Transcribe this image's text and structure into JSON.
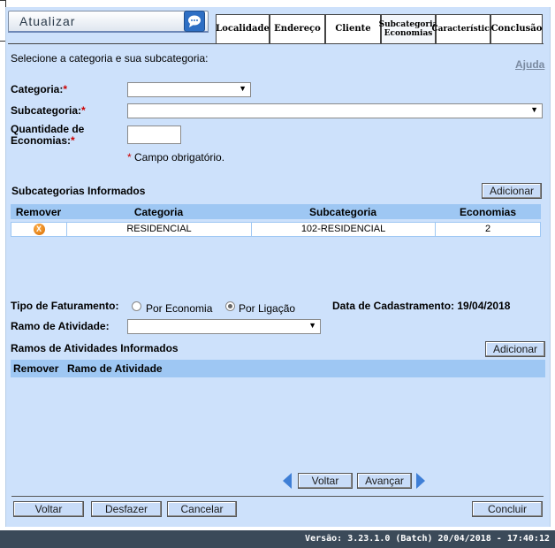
{
  "window": {
    "title": "Atualizar"
  },
  "tabs": [
    {
      "label": "Localidade"
    },
    {
      "label": "Endereço"
    },
    {
      "label": "Cliente"
    },
    {
      "label": "Subcategoria Economias"
    },
    {
      "label": "Característica"
    },
    {
      "label": "Conclusão"
    }
  ],
  "form": {
    "instruction": "Selecione a categoria e sua subcategoria:",
    "help_link": "Ajuda",
    "categoria_label": "Categoria:",
    "subcategoria_label": "Subcategoria:",
    "quantidade_label_line1": "Quantidade de",
    "quantidade_label_line2": "Economias:",
    "required_mark": "*",
    "required_note": "Campo obrigatório.",
    "categoria_value": "",
    "subcategoria_value": "",
    "quantidade_value": ""
  },
  "subcategorias": {
    "heading": "Subcategorias Informados",
    "add_button": "Adicionar",
    "columns": [
      "Remover",
      "Categoria",
      "Subcategoria",
      "Economias"
    ],
    "rows": [
      {
        "categoria": "RESIDENCIAL",
        "subcategoria": "102-RESIDENCIAL",
        "economias": "2",
        "remove_icon": "X"
      }
    ]
  },
  "faturamento": {
    "label": "Tipo de Faturamento:",
    "option1": "Por Economia",
    "option2": "Por Ligação",
    "selected": "Por Ligação",
    "data_cadastramento": "Data de Cadastramento: 19/04/2018"
  },
  "ramo": {
    "label": "Ramo de Atividade:",
    "value": "",
    "heading": "Ramos de Atividades Informados",
    "add_button": "Adicionar",
    "columns": [
      "Remover",
      "Ramo de Atividade"
    ]
  },
  "nav": {
    "back": "Voltar",
    "next": "Avançar"
  },
  "actions": {
    "voltar": "Voltar",
    "desfazer": "Desfazer",
    "cancelar": "Cancelar",
    "concluir": "Concluir"
  },
  "footer": {
    "version": "Versão: 3.23.1.0 (Batch) 20/04/2018 - 17:40:12"
  },
  "colors": {
    "panel": "#cde1fb",
    "table_header": "#9ec7f3",
    "footer": "#3b4a59",
    "required": "#cc0000"
  }
}
